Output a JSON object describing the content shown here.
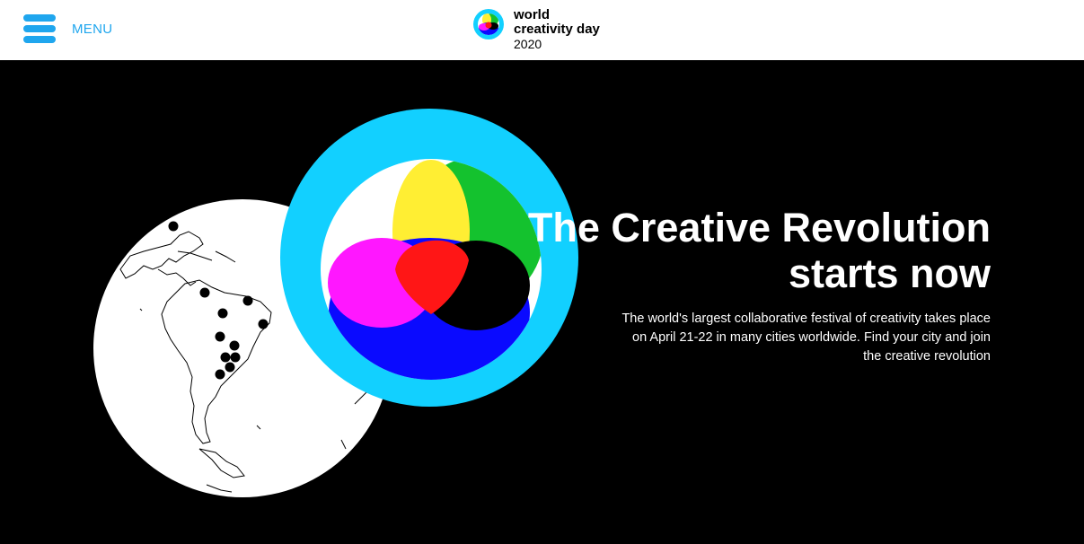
{
  "header": {
    "menu_label": "MENU",
    "logo": {
      "line1": "world",
      "line2": "creativity day",
      "line3": "2020"
    }
  },
  "hero": {
    "title": "The Creative Revolution starts now",
    "description": "The world's largest collaborative festival of creativity takes place on April 21-22 in many cities worldwide. Find your city and join the creative revolution"
  },
  "colors": {
    "accent": "#1fa6ee",
    "background": "#000000",
    "ring": "#12d0ff",
    "yellow": "#ffee33",
    "green": "#14c22e",
    "red": "#ff1616",
    "magenta": "#ff17ff",
    "blue": "#0a0aff"
  },
  "icons": [
    "hamburger-menu-icon",
    "world-creativity-day-logo-icon",
    "globe-illustration",
    "color-venn-circle-illustration"
  ]
}
